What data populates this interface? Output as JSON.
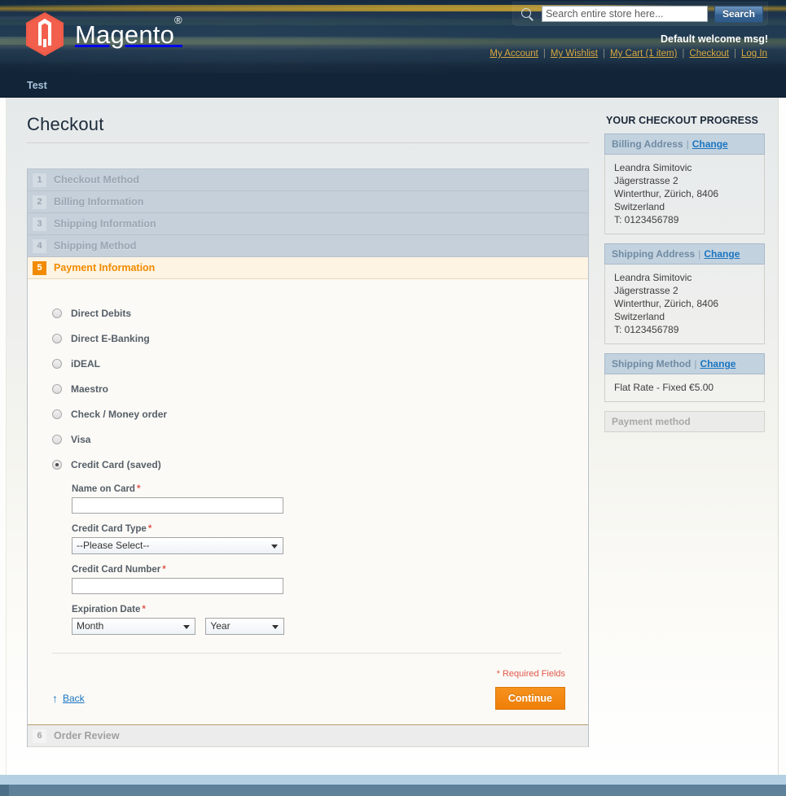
{
  "header": {
    "logo_text": "Magento",
    "logo_reg_mark": "®",
    "search": {
      "placeholder": "Search entire store here...",
      "value": "",
      "button_label": "Search"
    },
    "welcome_msg": "Default welcome msg!",
    "links": [
      {
        "label": "My Account"
      },
      {
        "label": "My Wishlist"
      },
      {
        "label": "My Cart (1 item)"
      },
      {
        "label": "Checkout"
      },
      {
        "label": "Log In"
      }
    ],
    "link_separator": "|"
  },
  "nav": {
    "items": [
      {
        "label": "Test"
      }
    ]
  },
  "main": {
    "page_title": "Checkout",
    "steps": [
      {
        "num": "1",
        "label": "Checkout Method",
        "state": "collapsed"
      },
      {
        "num": "2",
        "label": "Billing Information",
        "state": "collapsed"
      },
      {
        "num": "3",
        "label": "Shipping Information",
        "state": "collapsed"
      },
      {
        "num": "4",
        "label": "Shipping Method",
        "state": "collapsed"
      },
      {
        "num": "5",
        "label": "Payment Information",
        "state": "active"
      },
      {
        "num": "6",
        "label": "Order Review",
        "state": "plain"
      }
    ],
    "payment_methods": [
      {
        "label": "Direct Debits",
        "checked": false
      },
      {
        "label": "Direct E-Banking",
        "checked": false
      },
      {
        "label": "iDEAL",
        "checked": false
      },
      {
        "label": "Maestro",
        "checked": false
      },
      {
        "label": "Check / Money order",
        "checked": false
      },
      {
        "label": "Visa",
        "checked": false
      },
      {
        "label": "Credit Card (saved)",
        "checked": true
      }
    ],
    "cc_form": {
      "name_label": "Name on Card",
      "name_value": "",
      "type_label": "Credit Card Type",
      "type_value": "--Please Select--",
      "number_label": "Credit Card Number",
      "number_value": "",
      "exp_label": "Expiration Date",
      "exp_month_value": "Month",
      "exp_year_value": "Year",
      "required_marker": "*"
    },
    "required_note": "* Required Fields",
    "back_label": "Back",
    "back_icon": "arrow-up-icon",
    "continue_label": "Continue"
  },
  "sidebar": {
    "title": "YOUR CHECKOUT PROGRESS",
    "blocks": [
      {
        "title": "Billing Address",
        "change_label": "Change",
        "lines": [
          "Leandra Simitovic",
          "Jägerstrasse 2",
          "Winterthur, Zürich, 8406",
          "Switzerland",
          "T: 0123456789"
        ]
      },
      {
        "title": "Shipping Address",
        "change_label": "Change",
        "lines": [
          "Leandra Simitovic",
          "Jägerstrasse 2",
          "Winterthur, Zürich, 8406",
          "Switzerland",
          "T: 0123456789"
        ]
      },
      {
        "title": "Shipping Method",
        "change_label": "Change",
        "lines": [
          "Flat Rate - Fixed €5.00"
        ]
      }
    ],
    "pending_block": {
      "title": "Payment method"
    }
  },
  "colors": {
    "accent_orange": "#f28b00",
    "link_blue": "#1a75c0",
    "header_navy": "#1d3449",
    "required_red": "#e2574c",
    "step_collapsed_bg": "#c5d0da",
    "step_active_bg": "#fdf4e3"
  }
}
